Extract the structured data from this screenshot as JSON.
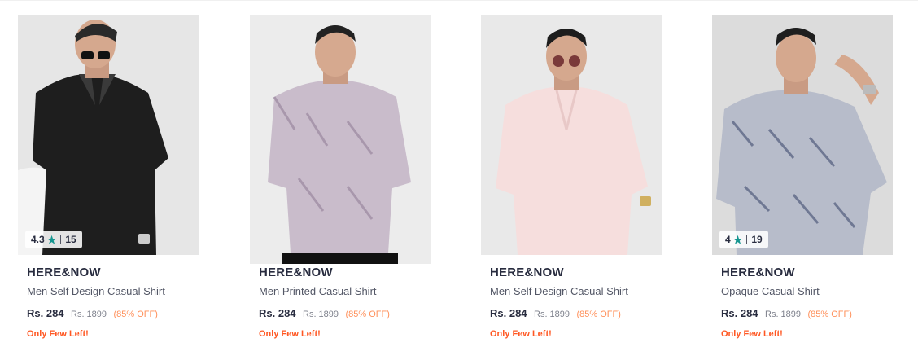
{
  "products": [
    {
      "brand": "HERE&NOW",
      "name": "Men Self Design Casual Shirt",
      "price": "Rs. 284",
      "mrp": "Rs. 1899",
      "discount": "(85% OFF)",
      "stock": "Only Few Left!",
      "rating": {
        "score": "4.3",
        "count": "15"
      },
      "shirt_color": "#1e1e1e",
      "bg_color": "#e6e6e6"
    },
    {
      "brand": "HERE&NOW",
      "name": "Men Printed Casual Shirt",
      "price": "Rs. 284",
      "mrp": "Rs. 1899",
      "discount": "(85% OFF)",
      "stock": "Only Few Left!",
      "rating": null,
      "shirt_color": "#c9bccb",
      "bg_color": "#ececec"
    },
    {
      "brand": "HERE&NOW",
      "name": "Men Self Design Casual Shirt",
      "price": "Rs. 284",
      "mrp": "Rs. 1899",
      "discount": "(85% OFF)",
      "stock": "Only Few Left!",
      "rating": null,
      "shirt_color": "#f6dedd",
      "bg_color": "#e9e9e9"
    },
    {
      "brand": "HERE&NOW",
      "name": "Opaque Casual Shirt",
      "price": "Rs. 284",
      "mrp": "Rs. 1899",
      "discount": "(85% OFF)",
      "stock": "Only Few Left!",
      "rating": {
        "score": "4",
        "count": "19"
      },
      "shirt_color": "#b7bcca",
      "bg_color": "#dcdcdc"
    }
  ],
  "theme": {
    "text_dark": "#282c3f",
    "text_muted": "#535766",
    "discount_color": "#ff905a",
    "stock_color": "#ff5722",
    "rating_star_color": "#14958f"
  }
}
